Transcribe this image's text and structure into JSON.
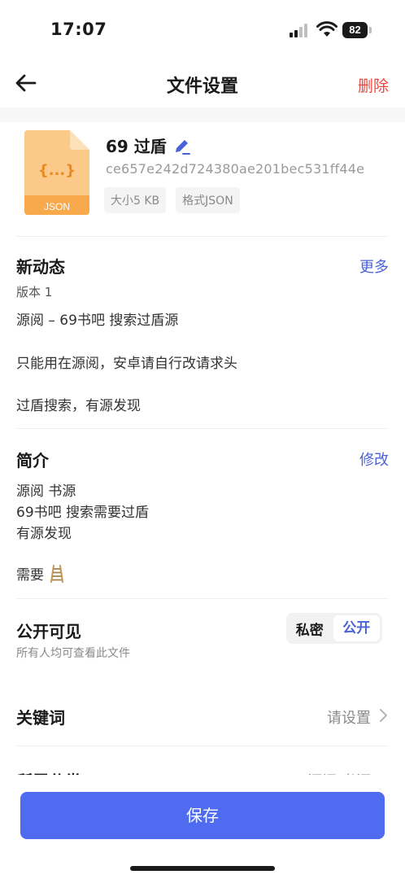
{
  "status_bar": {
    "time": "17:07",
    "battery": "82"
  },
  "nav": {
    "title": "文件设置",
    "delete_label": "删除"
  },
  "file": {
    "name": "69 过盾",
    "hash": "ce657e242d724380ae201bec531ff44e",
    "icon_label": "JSON",
    "icon_glyph": "{...}",
    "size_tag": "大小5 KB",
    "format_tag": "格式JSON"
  },
  "updates": {
    "title": "新动态",
    "more_label": "更多",
    "version": "版本 1",
    "lines": [
      "源阅 – 69书吧 搜索过盾源",
      "只能用在源阅，安卓请自行改请求头",
      "过盾搜索，有源发现"
    ]
  },
  "intro": {
    "title": "简介",
    "edit_label": "修改",
    "lines": [
      "源阅 书源",
      "69书吧 搜索需要过盾",
      "有源发现"
    ],
    "need_text": "需要"
  },
  "visibility": {
    "title": "公开可见",
    "hint": "所有人均可查看此文件",
    "options": [
      "私密",
      "公开"
    ],
    "selected": "公开"
  },
  "keywords": {
    "title": "关键词",
    "value": "请设置"
  },
  "category": {
    "title": "所属分类",
    "value": "源阅 书源"
  },
  "save_label": "保存",
  "colors": {
    "accent": "#4f6cf0",
    "link": "#4a62d9",
    "danger": "#e8473f",
    "file_icon": "#f7a94b"
  }
}
